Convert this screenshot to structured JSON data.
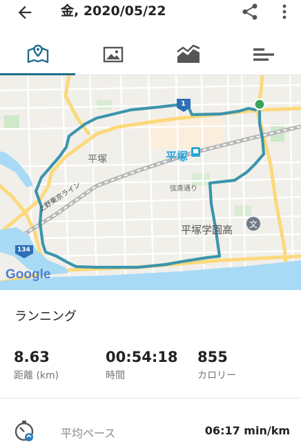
{
  "header": {
    "title": "金, 2020/05/22",
    "back_icon": "arrow-back-icon",
    "share_icon": "share-icon",
    "more_icon": "more-vert-icon"
  },
  "tabs": [
    {
      "icon": "map-icon",
      "selected": true
    },
    {
      "icon": "image-icon",
      "selected": false
    },
    {
      "icon": "area-chart-icon",
      "selected": false
    },
    {
      "icon": "sort-bars-icon",
      "selected": false
    }
  ],
  "map": {
    "labels": {
      "city": "平塚",
      "station": "平塚",
      "street": "弦斎通り",
      "school": "平塚学園高",
      "railway": "上野東京ライン",
      "route_shield_1": "1",
      "route_shield_134": "134",
      "attribution": "Google"
    }
  },
  "activity": {
    "name": "ランニング"
  },
  "stats": [
    {
      "value": "8.63",
      "label": "距離 (km)"
    },
    {
      "value": "00:54:18",
      "label": "時間"
    },
    {
      "value": "855",
      "label": "カロリー"
    }
  ],
  "pace": {
    "label": "平均ペース",
    "value": "06:17 min/km",
    "icon": "pace-gauge-icon"
  },
  "colors": {
    "accent": "#1e6e8c",
    "route": "#3c95ac",
    "start_marker": "#3aa45c",
    "water": "#a8daf6",
    "road_major": "#fcd97a"
  }
}
